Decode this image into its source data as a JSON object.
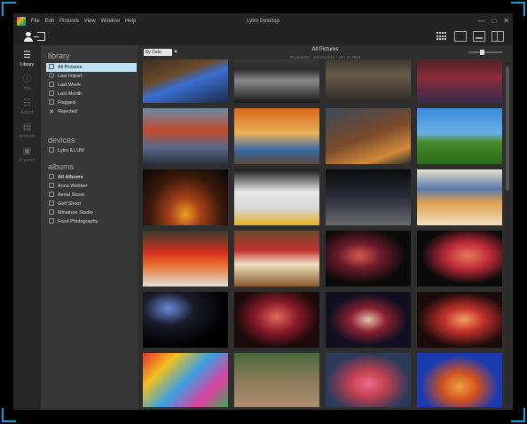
{
  "window": {
    "title": "Lytro Desktop",
    "menu": [
      "File",
      "Edit",
      "Pictures",
      "View",
      "Window",
      "Help"
    ],
    "controls": [
      "—",
      "□",
      "✕"
    ]
  },
  "rail": [
    {
      "label": "Library",
      "icon": "library-icon",
      "active": true
    },
    {
      "label": "Info",
      "icon": "info-icon",
      "active": false
    },
    {
      "label": "Adjust",
      "icon": "adjust-icon",
      "active": false
    },
    {
      "label": "Animate",
      "icon": "animate-icon",
      "active": false
    },
    {
      "label": "Present",
      "icon": "present-icon",
      "active": false
    }
  ],
  "sidebar": {
    "library_title": "library",
    "library_items": [
      {
        "label": "All Pictures",
        "icon": "pictures-icon",
        "selected": true
      },
      {
        "label": "Last Import",
        "icon": "clock-icon",
        "selected": false
      },
      {
        "label": "Last Week",
        "icon": "calendar-icon",
        "selected": false
      },
      {
        "label": "Last Month",
        "icon": "calendar-icon",
        "selected": false
      },
      {
        "label": "Flagged",
        "icon": "flag-icon",
        "selected": false
      },
      {
        "label": "Rejected",
        "icon": "reject-icon",
        "selected": false
      }
    ],
    "devices_title": "devices",
    "device_items": [
      {
        "label": "Lytro ILLUM",
        "icon": "camera-icon"
      }
    ],
    "albums_title": "albums",
    "album_items": [
      {
        "label": "All Albums",
        "icon": "albums-icon",
        "bold": true
      },
      {
        "label": "Anna Webber",
        "icon": "album-icon",
        "bold": false
      },
      {
        "label": "Aerial Shoot",
        "icon": "album-icon",
        "bold": false
      },
      {
        "label": "Golf Shoot",
        "icon": "album-icon",
        "bold": false
      },
      {
        "label": "Miniature Studio",
        "icon": "album-icon",
        "bold": false
      },
      {
        "label": "Food Photography",
        "icon": "album-icon",
        "bold": false
      }
    ]
  },
  "main": {
    "sort_label": "By Date",
    "title": "All Pictures",
    "subtitle": "25 pictures · Jun 03,2014 - Jun 17,2014",
    "zoom_level": 0.4
  },
  "thumbnails": [
    {
      "name": "thumb-blue-paper",
      "bg": "linear-gradient(160deg,#2b2219 0%,#6a4a2a 45%,#3a6fd1 60%,#1d2a4a 100%)"
    },
    {
      "name": "thumb-truck",
      "bg": "linear-gradient(180deg,#4a4a4a 0%,#2a2a2a 40%,#8a8a8a 60%,#1a1a1a 100%)"
    },
    {
      "name": "thumb-toy-cars",
      "bg": "linear-gradient(180deg,#1c1c1c 0%,#6a5a4a 50%,#2a2a2a 100%)"
    },
    {
      "name": "thumb-red-shoes",
      "bg": "linear-gradient(180deg,#2a1a1a 0%,#8a2c3a 55%,#3a2a4a 100%)"
    },
    {
      "name": "thumb-golden-gate",
      "bg": "linear-gradient(180deg,#6a8aa8 0%,#c24a2a 40%,#5a6a8a 70%,#2a3040 100%)"
    },
    {
      "name": "thumb-feet",
      "bg": "linear-gradient(180deg,#d86a1a 0%,#e8b05a 45%,#3a6aa8 75%,#5a4a3a 100%)"
    },
    {
      "name": "thumb-road-shoes",
      "bg": "linear-gradient(160deg,#3a4a5a 0%,#7a4a2a 50%,#d08a3a 80%,#2a2a2a 100%)"
    },
    {
      "name": "thumb-golf",
      "bg": "linear-gradient(180deg,#3a8ad8 0%,#6ab0e8 45%,#4a8a2a 60%,#2a6a1a 100%)"
    },
    {
      "name": "thumb-candles",
      "bg": "radial-gradient(ellipse at 50% 80%,#f0a020 0%,#a8401a 25%,#3a1a0a 60%,#0a0505 100%)"
    },
    {
      "name": "thumb-eggs",
      "bg": "linear-gradient(180deg,#1a1a1a 0%,#e8e8e8 40%,#d8d8d8 70%,#e8b020 100%)"
    },
    {
      "name": "thumb-alley",
      "bg": "linear-gradient(180deg,#0a0a10 0%,#2a2e3a 50%,#6a6a70 100%)"
    },
    {
      "name": "thumb-pancakes",
      "bg": "linear-gradient(180deg,#e8e0d0 0%,#5a7aa8 35%,#e0a050 60%,#f0e0c0 100%)"
    },
    {
      "name": "thumb-tomatoes",
      "bg": "linear-gradient(180deg,#3a3a2a 0%,#d83020 40%,#e86a2a 60%,#e0e0d8 100%)"
    },
    {
      "name": "thumb-sandwich",
      "bg": "linear-gradient(180deg,#6a4a2a 0%,#c23030 35%,#f0e0c0 60%,#8a5a30 100%)"
    },
    {
      "name": "thumb-hat-woman",
      "bg": "radial-gradient(ellipse at 40% 45%,#d85a4a 0%,#6a1a2a 30%,#0a0a0a 65%)"
    },
    {
      "name": "thumb-bubble-girl",
      "bg": "radial-gradient(ellipse at 60% 45%,#e87a5a 0%,#c02a3a 30%,#0a0a0a 65%)"
    },
    {
      "name": "thumb-bubbles",
      "bg": "radial-gradient(ellipse at 30% 30%,#6a8ad8 0%,#1a1a2a 30%,#000 70%)"
    },
    {
      "name": "thumb-lace-mask",
      "bg": "radial-gradient(ellipse at 50% 45%,#e06a5a 0%,#8a1a2a 35%,#1a0a0a 70%)"
    },
    {
      "name": "thumb-sunglasses",
      "bg": "radial-gradient(ellipse at 50% 50%,#e8c0b0 0%,#8a2030 30%,#101020 65%)"
    },
    {
      "name": "thumb-fire-hands",
      "bg": "radial-gradient(ellipse at 55% 50%,#f0a060 0%,#c0302a 30%,#1a0a0a 70%)"
    },
    {
      "name": "thumb-balloons",
      "bg": "linear-gradient(135deg,#e8302a 0%,#f0c020 25%,#3aa0e0 50%,#e040a0 75%,#30b050 100%)"
    },
    {
      "name": "thumb-motocross",
      "bg": "linear-gradient(180deg,#4a6a3a 0%,#8a7a5a 50%,#b09070 100%)"
    },
    {
      "name": "thumb-anemone",
      "bg": "radial-gradient(ellipse at 50% 55%,#f06a8a 0%,#c04050 30%,#2a3a5a 70%)"
    },
    {
      "name": "thumb-coral",
      "bg": "radial-gradient(ellipse at 50% 60%,#f0a040 0%,#d05020 30%,#1a3ab0 65%)"
    }
  ]
}
